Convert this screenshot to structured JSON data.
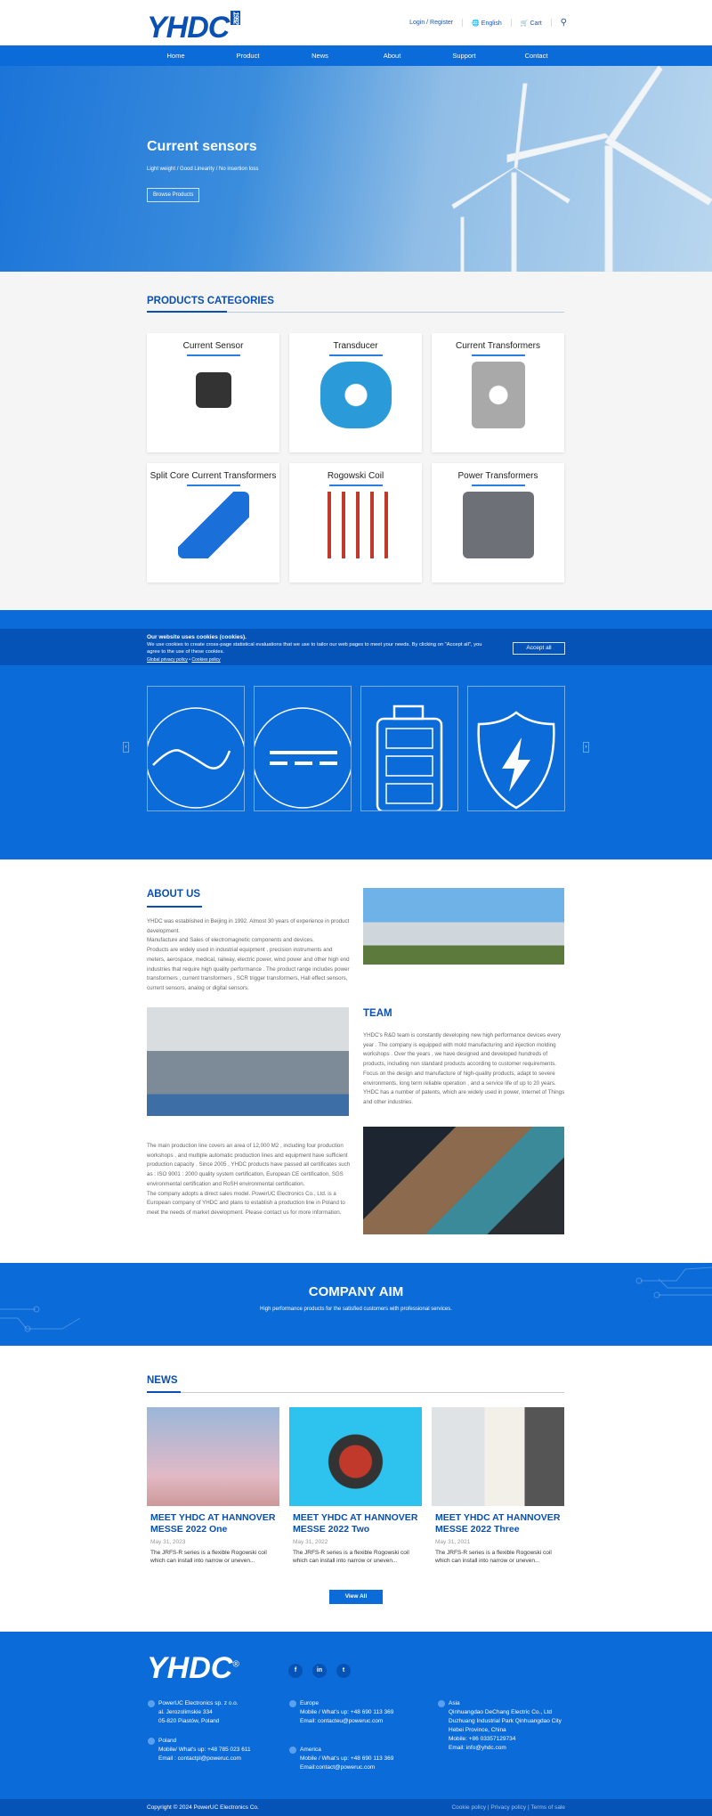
{
  "header": {
    "logo": "YHDC",
    "logo_year": "1992",
    "login": "Login / Register",
    "language": "English",
    "cart": "Cart",
    "icons": [
      "globe-icon",
      "cart-icon",
      "search-icon"
    ]
  },
  "nav": [
    "Home",
    "Product",
    "News",
    "About",
    "Support",
    "Contact"
  ],
  "hero": {
    "title": "Current sensors",
    "subtitle": "Light weight / Good Linearity / No insertion loss",
    "button": "Browse Products"
  },
  "products": {
    "title": "PRODUCTS CATEGORIES",
    "items": [
      "Current Sensor",
      "Transducer",
      "Current Transformers",
      "Split Core Current Transformers",
      "Rogowski Coil",
      "Power Transformers"
    ]
  },
  "cookie": {
    "title": "Our website uses cookies (cookies).",
    "text": "We use cookies to create cross-page statistical evaluations that we use to tailor our web pages to meet your needs. By clicking on \"Accept all\", you agree to the use of these cookies.",
    "privacy": "Global privacy policy",
    "bullet": "•",
    "cookies_link": "Cookies policy",
    "accept": "Accept all"
  },
  "features": {
    "icons": [
      "ac-wave-icon",
      "dc-icon",
      "battery-icon",
      "shield-bolt-icon"
    ]
  },
  "about": {
    "title": "ABOUT US",
    "text1": "YHDC was established in Beijing in 1992. Almost 30 years of experience in product development.",
    "text2": "Manufacture and Sales of electromagnetic components and devices.",
    "text3": "Products are widely used in industrial equipment , precision instruments and meters, aerospace, medical, railway, electric power, wind power and other high end industries that require high quality performance . The product range includes power transformers , current transformers , SCR trigger transformers, Hall effect sensors, current sensors, analog or digital sensors.",
    "team_title": "TEAM",
    "team_text": "YHDC's R&D team is constantly developing new high performance devices every year . The company is equipped with mold manufacturing and injection molding workshops . Over the years , we have designed and developed hundreds of products, including non standard products according to customer requirements. Focus on the design and manufacture of high-quality products, adapt to severe environments, long term reliable operation , and a service life of up to 20 years. YHDC has a number of patents, which are widely used in power, Internet of Things and other industries.",
    "prod_text1": "The main production line covers an area of 12,000 M2 , including four production workshops , and multiple automatic production lines and equipment have sufficient production capacity . Since 2005 , YHDC products have passed all certificates such as : ISO 9001 : 2000 quality system certification, European CE certification, SGS environmental certification and RoSH environmental certification.",
    "prod_text2": "The company adopts a direct sales model. PowerUC Electronics Co., Ltd. is a European company of YHDC and plans to establish a production line in Poland to meet the needs of market development. Please contact us for more information."
  },
  "aim": {
    "title": "COMPANY AIM",
    "text": "High performance products for the satisfied customers with professional services."
  },
  "news": {
    "title": "NEWS",
    "items": [
      {
        "title": "MEET YHDC AT HANNOVER MESSE 2022 One",
        "date": "May 31, 2023",
        "excerpt": "The JRFS-R series is a flexible Rogowski coil which can install into narrow or uneven..."
      },
      {
        "title": "MEET YHDC AT HANNOVER MESSE 2022 Two",
        "date": "May 31, 2022",
        "excerpt": "The JRFS-R series is a flexible Rogowski coil which can install into narrow or uneven..."
      },
      {
        "title": "MEET YHDC AT HANNOVER MESSE 2022 Three",
        "date": "May 31, 2021",
        "excerpt": "The JRFS-R series is a flexible Rogowski coil which can install into narrow or uneven..."
      }
    ],
    "view_all": "View All"
  },
  "footer": {
    "logo": "YHDC",
    "registered": "®",
    "social": [
      "f",
      "in",
      "t"
    ],
    "hq": [
      "PowerUC Electronics sp. z o.o.",
      "al. Jerozolimskie 334",
      "05-820 Piastów, Poland"
    ],
    "poland": [
      "Poland",
      "Mobile/ What's up:  +48 785 023 611",
      "Email : contactpl@poweruc.com"
    ],
    "europe": [
      "Europe",
      "Mobile / What's up:  +48 690 113 369",
      "Email: contacteu@poweruc.com"
    ],
    "america": [
      "America",
      "Mobile / What's up:  +48 690 113 369",
      "Email:contact@poweruc.com"
    ],
    "asia": [
      "Asia",
      "Qinhuangdao DeChang Electric Co., Ltd",
      "Duzhuang Industrial Park Qinhuangdao City",
      "Hebei Province, China",
      "Mobile:  +86 03357129734",
      "Email: info@yhdc.com"
    ],
    "copyright": "Copyright © 2024 PowerUC Electronics Co.",
    "links": [
      "Cookie policy",
      "Privacy policy",
      "Terms of sale"
    ]
  },
  "colors": {
    "brand": "#0a6bd9",
    "dark": "#0653b8",
    "heading": "#0a4fb3"
  }
}
